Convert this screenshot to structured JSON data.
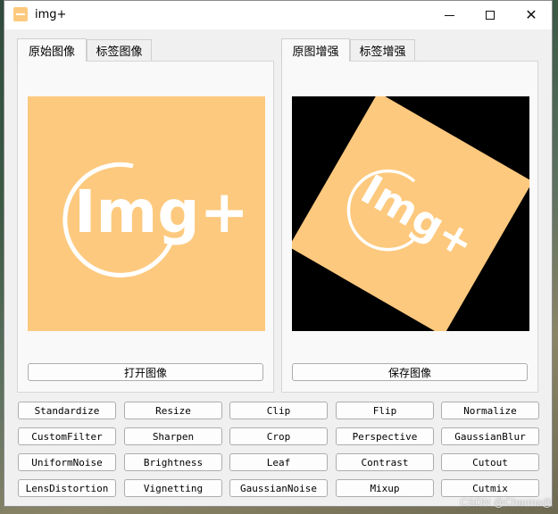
{
  "window": {
    "title": "img+",
    "colors": {
      "accent": "#fdc97e",
      "preview_bg": "#000000"
    }
  },
  "left_panel": {
    "tabs": [
      {
        "label": "原始图像",
        "active": true
      },
      {
        "label": "标签图像",
        "active": false
      }
    ],
    "logo_text": "Img+",
    "button_label": "打开图像"
  },
  "right_panel": {
    "tabs": [
      {
        "label": "原图增强",
        "active": true
      },
      {
        "label": "标签增强",
        "active": false
      }
    ],
    "logo_text": "Img+",
    "rotation_degrees": 30,
    "button_label": "保存图像"
  },
  "augmentations": [
    [
      "Standardize",
      "Resize",
      "Clip",
      "Flip",
      "Normalize"
    ],
    [
      "CustomFilter",
      "Sharpen",
      "Crop",
      "Perspective",
      "GaussianBlur"
    ],
    [
      "UniformNoise",
      "Brightness",
      "Leaf",
      "Contrast",
      "Cutout"
    ],
    [
      "LensDistortion",
      "Vignetting",
      "GaussianNoise",
      "Mixup",
      "Cutmix"
    ]
  ],
  "watermark": "CSDN @Charms@"
}
